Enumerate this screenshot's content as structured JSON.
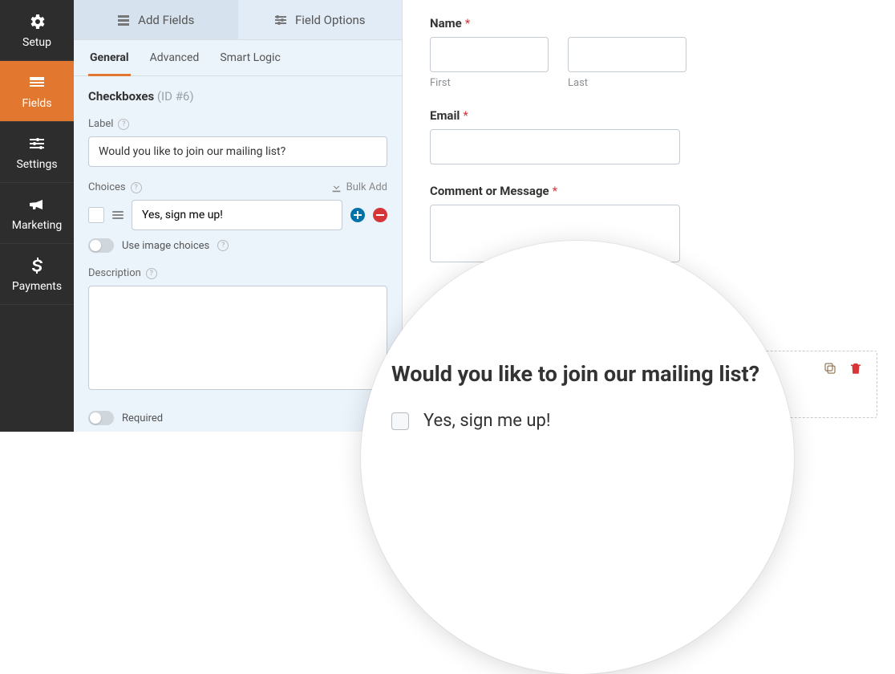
{
  "nav": {
    "items": [
      {
        "label": "Setup"
      },
      {
        "label": "Fields"
      },
      {
        "label": "Settings"
      },
      {
        "label": "Marketing"
      },
      {
        "label": "Payments"
      }
    ]
  },
  "tabs": {
    "add_fields": "Add Fields",
    "field_options": "Field Options"
  },
  "subtabs": {
    "general": "General",
    "advanced": "Advanced",
    "smart_logic": "Smart Logic"
  },
  "field": {
    "type": "Checkboxes",
    "id_label": "(ID #6)",
    "label_caption": "Label",
    "label_value": "Would you like to join our mailing list?",
    "choices_caption": "Choices",
    "bulk_add": "Bulk Add",
    "choice_value": "Yes, sign me up!",
    "image_choices": "Use image choices",
    "description_caption": "Description",
    "required": "Required"
  },
  "preview": {
    "name_label": "Name",
    "first": "First",
    "last": "Last",
    "email_label": "Email",
    "comment_label": "Comment or Message"
  },
  "zoom": {
    "heading": "Would you like to join our mailing list?",
    "option": "Yes, sign me up!"
  }
}
